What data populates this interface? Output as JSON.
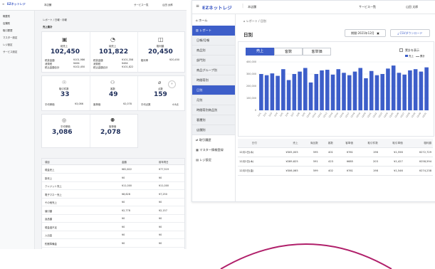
{
  "left": {
    "logo": "EZネットレジ",
    "store": "本店舗",
    "services_menu": "サービス一覧",
    "user": "山田 太郎",
    "breadcrumb": "レポート / 日報・月報",
    "sidebar": [
      {
        "label": "概要別"
      },
      {
        "label": "店舗別"
      },
      {
        "label": "取引履歴"
      },
      {
        "label": "マスター設定"
      },
      {
        "label": "レジ設定"
      },
      {
        "label": "サービス設定"
      }
    ],
    "section_title": "売上集計",
    "stats_row1": [
      {
        "label": "総売上",
        "value": "102,450",
        "unit": "円",
        "rows": [
          [
            "税抜金額",
            "¥101,986"
          ],
          [
            "消費税",
            "¥464"
          ],
          [
            "税込金額合計",
            "¥102,450"
          ]
        ]
      },
      {
        "label": "純売上",
        "value": "101,822",
        "unit": "円",
        "rows": [
          [
            "税抜金額",
            "¥101,358"
          ],
          [
            "消費税",
            "¥464"
          ],
          [
            "税込金額合計",
            "¥101,822"
          ]
        ]
      },
      {
        "label": "粗利額",
        "value": "20,450",
        "unit": "円",
        "rows": [
          [
            "粗利率",
            "¥20,450"
          ]
        ]
      }
    ],
    "stats_row2": [
      {
        "label": "取引件数",
        "value": "33",
        "unit": "件",
        "sub": "平均単価",
        "subv": "¥3,086"
      },
      {
        "label": "客数",
        "value": "49",
        "unit": "名",
        "sub": "客単価",
        "subv": "¥2,078"
      },
      {
        "label": "点数",
        "value": "159",
        "unit": "点",
        "sub": "平均点数",
        "subv": "4.8点"
      }
    ],
    "stats_row3": [
      {
        "label": "平均単価",
        "value": "3,086",
        "unit": "円"
      },
      {
        "label": "客単価",
        "value": "2,078",
        "unit": "円"
      }
    ],
    "table_head": [
      "項目",
      "金額",
      "前年同日"
    ],
    "table_rows": [
      [
        "現金売上",
        "¥82,822",
        "¥77,519"
      ],
      [
        "掛売上",
        "¥0",
        "¥0"
      ],
      [
        "クレジット売上",
        "¥11,000",
        "¥11,000"
      ],
      [
        "電子マネー売上",
        "¥8,628",
        "¥7,250"
      ],
      [
        "その他売上",
        "¥0",
        "¥0"
      ],
      [
        "値引額",
        "¥2,778",
        "¥2,157"
      ],
      [
        "返品額",
        "¥0",
        "¥0"
      ],
      [
        "現金過不足",
        "¥0",
        "¥0"
      ],
      [
        "入出金",
        "¥0",
        "¥0"
      ],
      [
        "釣銭準備金",
        "¥0",
        "¥0"
      ]
    ]
  },
  "right": {
    "logo": "EZネットレジ",
    "store": "本店舗",
    "services_menu": "サービス一覧",
    "user": "山田 太郎",
    "breadcrumb": "レポート / 日別",
    "page_title": "日別",
    "period_label": "期間:2021年12月",
    "csv_button": "CSVダウンロード",
    "sidebar": [
      {
        "label": "ホーム",
        "kind": "top",
        "icon": "⌂"
      },
      {
        "label": "レポート",
        "kind": "active",
        "icon": "▥"
      },
      {
        "label": "日報/月報",
        "kind": "sub"
      },
      {
        "label": "商品別",
        "kind": "sub"
      },
      {
        "label": "部門別",
        "kind": "sub"
      },
      {
        "label": "商品グループ別",
        "kind": "sub"
      },
      {
        "label": "時間帯別",
        "kind": "sub"
      },
      {
        "label": "日別",
        "kind": "subactive"
      },
      {
        "label": "月別",
        "kind": "sub"
      },
      {
        "label": "時間帯別商品別",
        "kind": "sub"
      },
      {
        "label": "客層別",
        "kind": "sub"
      },
      {
        "label": "店舗別",
        "kind": "sub"
      },
      {
        "label": "取引履歴",
        "kind": "top",
        "icon": "⇄"
      },
      {
        "label": "マスター情報登録",
        "kind": "top",
        "icon": "▦"
      },
      {
        "label": "レジ設定",
        "kind": "top",
        "icon": "▤"
      }
    ],
    "tabs": [
      "売上",
      "客数",
      "客単価"
    ],
    "cumulative_label": "累計を表示",
    "legend": [
      "売上",
      "累計"
    ],
    "table_head": [
      "日付",
      "売上",
      "商品数",
      "客数",
      "客単価",
      "取引件数",
      "取引単価",
      "粗利額"
    ],
    "table_rows": [
      [
        "12月1日(水)",
        "¥305,005",
        "595",
        "401",
        "¥761",
        "196",
        "¥1,556",
        "¥272,729"
      ],
      [
        "12月2日(木)",
        "¥289,625",
        "591",
        "423",
        "¥685",
        "203",
        "¥1,427",
        "¥258,594"
      ],
      [
        "12月3日(金)",
        "¥306,065",
        "599",
        "402",
        "¥761",
        "198",
        "¥1,546",
        "¥274,238"
      ]
    ]
  },
  "chart_data": {
    "type": "bar",
    "title": "",
    "xlabel": "",
    "ylabel": "",
    "ylim": [
      0,
      400000
    ],
    "yticks": [
      "400,000",
      "300,000",
      "200,000",
      "100,000",
      "0"
    ],
    "categories": [
      "12/1",
      "12/2",
      "12/3",
      "12/4",
      "12/5",
      "12/6",
      "12/7",
      "12/8",
      "12/9",
      "12/10",
      "12/11",
      "12/12",
      "12/13",
      "12/14",
      "12/15",
      "12/16",
      "12/17",
      "12/18",
      "12/19",
      "12/20",
      "12/21",
      "12/22",
      "12/23",
      "12/24",
      "12/25",
      "12/26",
      "12/27",
      "12/28",
      "12/29",
      "12/30",
      "12/31"
    ],
    "values": [
      300000,
      290000,
      305000,
      285000,
      340000,
      250000,
      300000,
      320000,
      350000,
      230000,
      300000,
      330000,
      335000,
      295000,
      340000,
      310000,
      290000,
      320000,
      350000,
      265000,
      325000,
      290000,
      300000,
      345000,
      370000,
      310000,
      295000,
      330000,
      340000,
      320000,
      355000
    ],
    "color": "#3d5ec9"
  }
}
